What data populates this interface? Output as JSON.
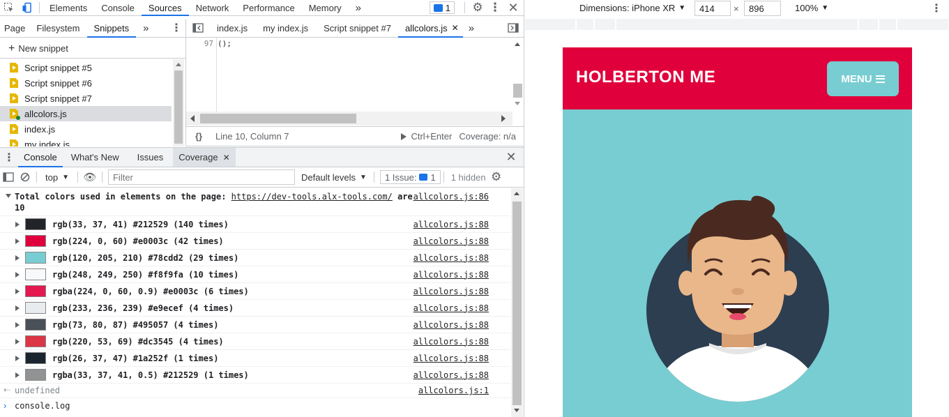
{
  "toolbar": {
    "tabs": [
      "Elements",
      "Console",
      "Sources",
      "Network",
      "Performance",
      "Memory"
    ],
    "active_tab": "Sources",
    "more": "»",
    "issues_count": "1"
  },
  "navigator": {
    "tabs": [
      "Page",
      "Filesystem",
      "Snippets"
    ],
    "active_tab": "Snippets",
    "more": "»",
    "new_snippet": "New snippet",
    "files": [
      "Script snippet #5",
      "Script snippet #6",
      "Script snippet #7",
      "allcolors.js",
      "index.js",
      "my index.js"
    ],
    "selected_file": "allcolors.js"
  },
  "editor": {
    "tabs": [
      "index.js",
      "my index.js",
      "Script snippet #7",
      "allcolors.js"
    ],
    "active_tab": "allcolors.js",
    "more": "»",
    "line_number": "97",
    "line_code": "();",
    "status_braces": "{}",
    "status_position": "Line 10, Column 7",
    "run_label": "Ctrl+Enter",
    "coverage": "Coverage: n/a"
  },
  "drawer": {
    "tabs": [
      "Console",
      "What's New",
      "Issues",
      "Coverage"
    ],
    "active_tab": "Console",
    "context": "top",
    "filter_placeholder": "Filter",
    "levels": "Default levels",
    "issues_label": "1 Issue:",
    "issues_count": "1",
    "hidden": "1 hidden"
  },
  "console": {
    "header_prefix": "Total colors used in elements on the page: ",
    "header_link": "https://dev-tools.alx-tools.com/",
    "header_suffix": " are",
    "header_count": "10",
    "header_source": "allcolors.js:86",
    "rows": [
      {
        "text": "rgb(33, 37, 41) #212529 (140 times)",
        "color": "#212529",
        "source": "allcolors.js:88"
      },
      {
        "text": "rgb(224, 0, 60) #e0003c (42 times)",
        "color": "#e0003c",
        "source": "allcolors.js:88"
      },
      {
        "text": "rgb(120, 205, 210) #78cdd2 (29 times)",
        "color": "#78cdd2",
        "source": "allcolors.js:88"
      },
      {
        "text": "rgb(248, 249, 250) #f8f9fa (10 times)",
        "color": "#f8f9fa",
        "source": "allcolors.js:88"
      },
      {
        "text": "rgba(224, 0, 60, 0.9) #e0003c (6 times)",
        "color": "rgba(224,0,60,0.9)",
        "source": "allcolors.js:88"
      },
      {
        "text": "rgb(233, 236, 239) #e9ecef (4 times)",
        "color": "#e9ecef",
        "source": "allcolors.js:88"
      },
      {
        "text": "rgb(73, 80, 87) #495057 (4 times)",
        "color": "#495057",
        "source": "allcolors.js:88"
      },
      {
        "text": "rgb(220, 53, 69) #dc3545 (4 times)",
        "color": "#dc3545",
        "source": "allcolors.js:88"
      },
      {
        "text": "rgb(26, 37, 47) #1a252f (1 times)",
        "color": "#1a252f",
        "source": "allcolors.js:88"
      },
      {
        "text": "rgba(33, 37, 41, 0.5) #212529 (1 times)",
        "color": "rgba(33,37,41,0.5)",
        "source": "allcolors.js:88"
      }
    ],
    "result": "undefined",
    "result_source": "allcolors.js:1",
    "input": "console.log"
  },
  "device": {
    "dimensions_label": "Dimensions: iPhone XR",
    "width": "414",
    "height": "896",
    "times": "×",
    "zoom": "100%"
  },
  "page": {
    "brand": "HOLBERTON ME",
    "menu": "MENU",
    "colors": {
      "header": "#e0003c",
      "body": "#78cdd2",
      "circle": "#2c3e50"
    }
  }
}
